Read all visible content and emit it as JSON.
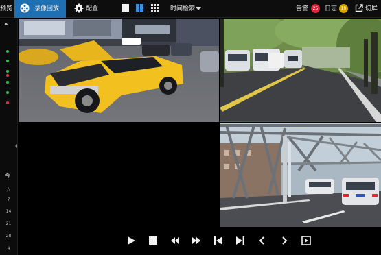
{
  "header": {
    "preview_label": "预览",
    "playback_label": "录像回放",
    "config_label": "配置",
    "time_search_label": "时间检索",
    "alarm_label": "告警",
    "alarm_count": "25",
    "log_label": "日志",
    "log_count": "19",
    "switch_screen_label": "切屏"
  },
  "calendar": {
    "today_label": "今",
    "weekday_label": "六",
    "days": [
      "7",
      "14",
      "21",
      "28",
      "4"
    ]
  },
  "icons": {
    "playback": "film-reel-icon",
    "config": "gear-icon",
    "switch_screen": "external-link-icon",
    "controls": [
      "play-icon",
      "stop-icon",
      "rewind-icon",
      "fast-forward-icon",
      "previous-frame-icon",
      "next-frame-icon",
      "chevron-left-icon",
      "chevron-right-icon",
      "snapshot-icon"
    ]
  },
  "colors": {
    "accent": "#1f6fb3",
    "topbar": "#0d0d0d",
    "alarm_badge": "#d9283a",
    "log_badge": "#d6a400",
    "channel_online": "#2ec24a",
    "channel_alarm": "#e0323d"
  },
  "channel_status": [
    "online",
    "online",
    "online",
    "alarm",
    "online",
    "online",
    "alarm"
  ],
  "video": {
    "layout": "2x2",
    "cells": [
      "street-taxi-scene",
      "tree-lined-road-scene",
      "no-signal",
      "steel-bridge-scene"
    ]
  }
}
